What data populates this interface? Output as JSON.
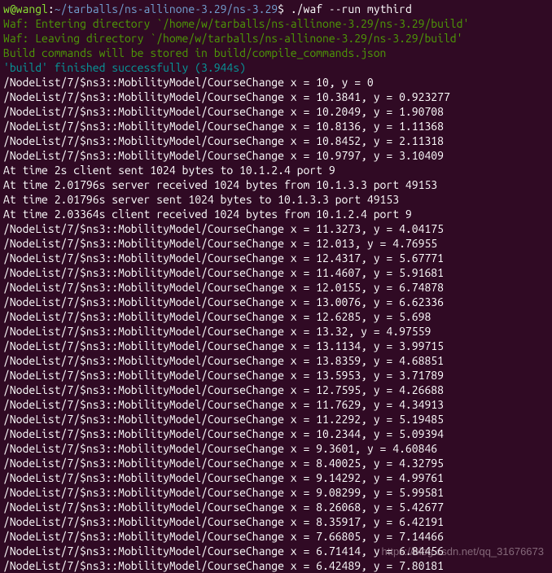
{
  "prompt": {
    "user": "w@wangl",
    "sep1": ":",
    "path": "~/tarballs/ns-allinone-3.29/ns-3.29",
    "dollar": "$ ",
    "command": "./waf --run mythird"
  },
  "waf": {
    "entering": "Waf: Entering directory `/home/w/tarballs/ns-allinone-3.29/ns-3.29/build'",
    "leaving": "Waf: Leaving directory `/home/w/tarballs/ns-allinone-3.29/ns-3.29/build'",
    "compile": "Build commands will be stored in build/compile_commands.json",
    "finished": "'build' finished successfully (3.944s)"
  },
  "lines": [
    "/NodeList/7/$ns3::MobilityModel/CourseChange x = 10, y = 0",
    "/NodeList/7/$ns3::MobilityModel/CourseChange x = 10.3841, y = 0.923277",
    "/NodeList/7/$ns3::MobilityModel/CourseChange x = 10.2049, y = 1.90708",
    "/NodeList/7/$ns3::MobilityModel/CourseChange x = 10.8136, y = 1.11368",
    "/NodeList/7/$ns3::MobilityModel/CourseChange x = 10.8452, y = 2.11318",
    "/NodeList/7/$ns3::MobilityModel/CourseChange x = 10.9797, y = 3.10409",
    "At time 2s client sent 1024 bytes to 10.1.2.4 port 9",
    "At time 2.01796s server received 1024 bytes from 10.1.3.3 port 49153",
    "At time 2.01796s server sent 1024 bytes to 10.1.3.3 port 49153",
    "At time 2.03364s client received 1024 bytes from 10.1.2.4 port 9",
    "/NodeList/7/$ns3::MobilityModel/CourseChange x = 11.3273, y = 4.04175",
    "/NodeList/7/$ns3::MobilityModel/CourseChange x = 12.013, y = 4.76955",
    "/NodeList/7/$ns3::MobilityModel/CourseChange x = 12.4317, y = 5.67771",
    "/NodeList/7/$ns3::MobilityModel/CourseChange x = 11.4607, y = 5.91681",
    "/NodeList/7/$ns3::MobilityModel/CourseChange x = 12.0155, y = 6.74878",
    "/NodeList/7/$ns3::MobilityModel/CourseChange x = 13.0076, y = 6.62336",
    "/NodeList/7/$ns3::MobilityModel/CourseChange x = 12.6285, y = 5.698",
    "/NodeList/7/$ns3::MobilityModel/CourseChange x = 13.32, y = 4.97559",
    "/NodeList/7/$ns3::MobilityModel/CourseChange x = 13.1134, y = 3.99715",
    "/NodeList/7/$ns3::MobilityModel/CourseChange x = 13.8359, y = 4.68851",
    "/NodeList/7/$ns3::MobilityModel/CourseChange x = 13.5953, y = 3.71789",
    "/NodeList/7/$ns3::MobilityModel/CourseChange x = 12.7595, y = 4.26688",
    "/NodeList/7/$ns3::MobilityModel/CourseChange x = 11.7629, y = 4.34913",
    "/NodeList/7/$ns3::MobilityModel/CourseChange x = 11.2292, y = 5.19485",
    "/NodeList/7/$ns3::MobilityModel/CourseChange x = 10.2344, y = 5.09394",
    "/NodeList/7/$ns3::MobilityModel/CourseChange x = 9.3601, y = 4.60846",
    "/NodeList/7/$ns3::MobilityModel/CourseChange x = 8.40025, y = 4.32795",
    "/NodeList/7/$ns3::MobilityModel/CourseChange x = 9.14292, y = 4.99761",
    "/NodeList/7/$ns3::MobilityModel/CourseChange x = 9.08299, y = 5.99581",
    "/NodeList/7/$ns3::MobilityModel/CourseChange x = 8.26068, y = 5.42677",
    "/NodeList/7/$ns3::MobilityModel/CourseChange x = 8.35917, y = 6.42191",
    "/NodeList/7/$ns3::MobilityModel/CourseChange x = 7.66805, y = 7.14466",
    "/NodeList/7/$ns3::MobilityModel/CourseChange x = 6.71414, y = 6.84456",
    "/NodeList/7/$ns3::MobilityModel/CourseChange x = 6.42489, y = 7.80181"
  ],
  "watermark": "https://blog.csdn.net/qq_31676673"
}
